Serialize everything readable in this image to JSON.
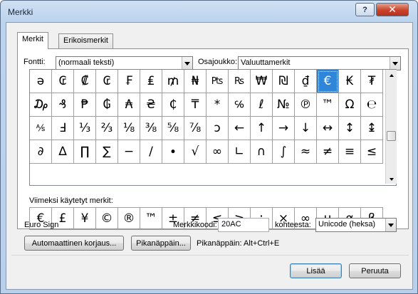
{
  "window": {
    "title": "Merkki"
  },
  "titlebar": {
    "help_label": "?",
    "close_label": "✕"
  },
  "tabs": [
    {
      "label": "Merkit"
    },
    {
      "label": "Erikoismerkit"
    }
  ],
  "font": {
    "label": "Fontti:",
    "value": "(normaali teksti)"
  },
  "subset": {
    "label": "Osajoukko:",
    "value": "Valuuttamerkit"
  },
  "symbols": [
    "ə",
    "₢",
    "₡",
    "₢",
    "₣",
    "₤",
    "₥",
    "₦",
    "₧",
    "₨",
    "₩",
    "₪",
    "₫",
    "€",
    "₭",
    "₮",
    "₯",
    "₰",
    "₱",
    "₲",
    "₳",
    "₴",
    "₵",
    "₸",
    "*",
    "℅",
    "ℓ",
    "№",
    "℗",
    "™",
    "Ω",
    "℮",
    "⅍",
    "Ⅎ",
    "⅓",
    "⅔",
    "⅛",
    "⅜",
    "⅝",
    "⅞",
    "ↄ",
    "←",
    "↑",
    "→",
    "↓",
    "↔",
    "↕",
    "↨",
    "∂",
    "∆",
    "∏",
    "∑",
    "−",
    "∕",
    "∙",
    "√",
    "∞",
    "∟",
    "∩",
    "∫",
    "≈",
    "≠",
    "≡",
    "≤"
  ],
  "selected_symbol": "€",
  "recent": {
    "label": "Viimeksi käytetyt merkit:",
    "items": [
      "€",
      "£",
      "¥",
      "©",
      "®",
      "™",
      "±",
      "≠",
      "≤",
      "≥",
      "÷",
      "×",
      "∞",
      "µ",
      "α",
      "β"
    ]
  },
  "char_name": "Euro Sign",
  "char_code": {
    "label": "Merkkikoodi:",
    "value": "20AC"
  },
  "from": {
    "label": "kohteesta:",
    "value": "Unicode (heksa)"
  },
  "buttons": {
    "autocorrect": "Automaattinen korjaus...",
    "shortcut_key": "Pikanäppäin...",
    "insert": "Lisää",
    "cancel": "Peruuta"
  },
  "shortcut_text": "Pikanäppäin: Alt+Ctrl+E"
}
